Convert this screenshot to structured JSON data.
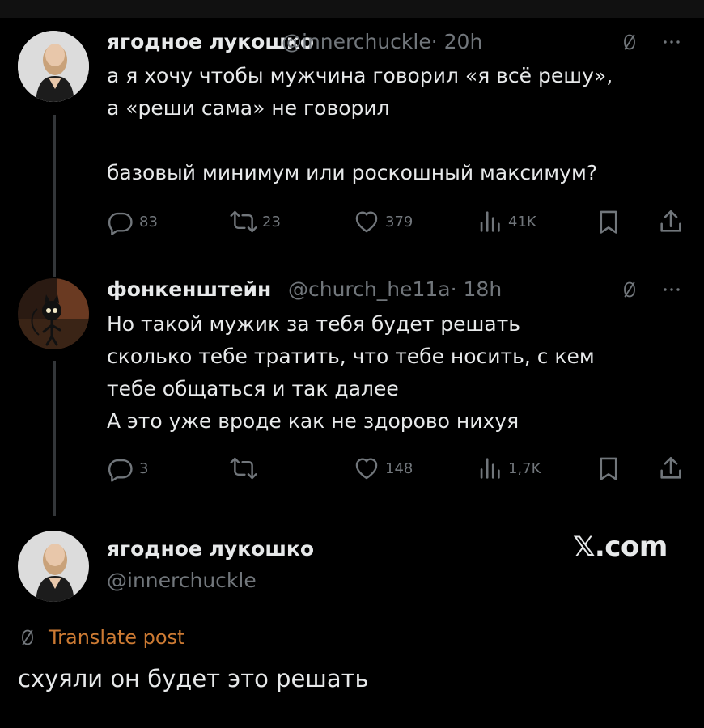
{
  "tweets": [
    {
      "name": "ягодное лукошко",
      "handle": "@innerchuckle",
      "time": "· 20h",
      "lines": [
        "а я хочу чтобы мужчина говорил «я всё решу»,",
        "а «реши сама» не говорил",
        "",
        "базовый минимум или роскошный максимум?"
      ],
      "replies": "83",
      "reposts": "23",
      "likes": "379",
      "views": "41K"
    },
    {
      "name": "фонкенштейн",
      "handle": "@church_he11a",
      "time": "· 18h",
      "lines": [
        "Но такой мужик за тебя будет решать",
        "сколько тебе тратить, что тебе носить, с кем",
        "тебе общаться и так далее",
        "А это уже вроде как не здорово нихуя"
      ],
      "replies": "3",
      "reposts": "",
      "likes": "148",
      "views": "1,7K"
    }
  ],
  "reply_post": {
    "name": "ягодное лукошко",
    "handle": "@innerchuckle",
    "brand": "𝕏.com",
    "translate_label": "Translate post",
    "text": "схуяли он будет это решать"
  },
  "icons": [
    "translate-slash-icon",
    "more-icon",
    "reply-icon",
    "repost-icon",
    "like-icon",
    "views-icon",
    "bookmark-icon",
    "share-icon"
  ],
  "colors": {
    "background": "#000000",
    "text": "#e7e9ea",
    "muted": "#71767b",
    "translate_link": "#cc7a33",
    "thread_line": "#333639"
  }
}
